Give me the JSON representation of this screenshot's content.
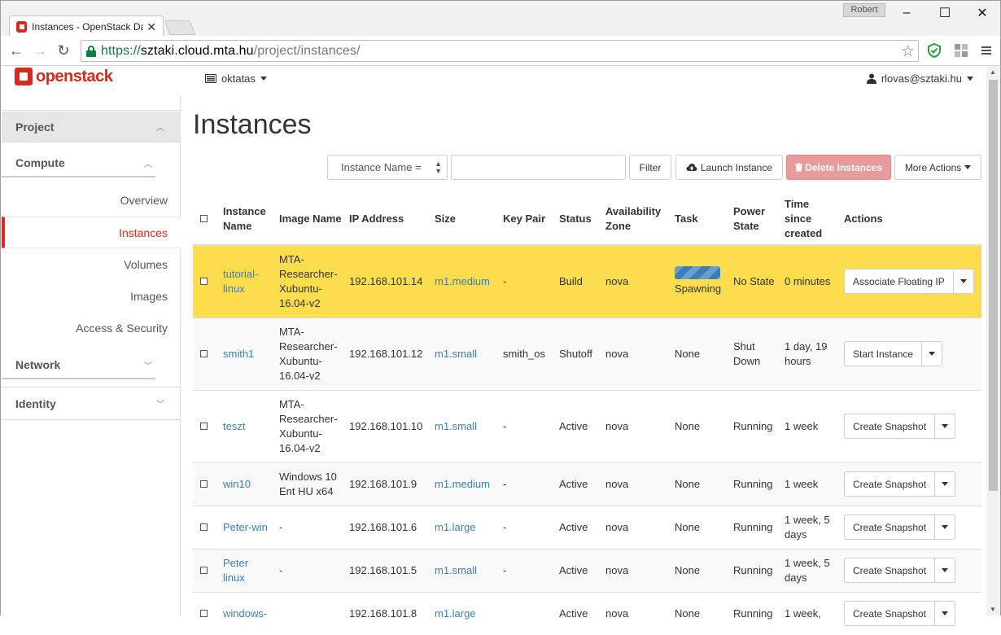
{
  "browser": {
    "tab_title": "Instances - OpenStack Da",
    "user_badge": "Robert",
    "url_scheme": "https://",
    "url_host": "sztaki.cloud.mta.hu",
    "url_path": "/project/instances/"
  },
  "header": {
    "logo_text": "openstack",
    "project": "oktatas",
    "user": "rlovas@sztaki.hu"
  },
  "sidebar": {
    "project": "Project",
    "compute": "Compute",
    "items": [
      "Overview",
      "Instances",
      "Volumes",
      "Images",
      "Access & Security"
    ],
    "active_item": "Instances",
    "network": "Network",
    "identity": "Identity"
  },
  "main": {
    "title": "Instances",
    "filter": {
      "field": "Instance Name =",
      "filter_label": "Filter",
      "launch_label": "Launch Instance",
      "delete_label": "Delete Instances",
      "more_label": "More Actions"
    },
    "columns": [
      "Instance Name",
      "Image Name",
      "IP Address",
      "Size",
      "Key Pair",
      "Status",
      "Availability Zone",
      "Task",
      "Power State",
      "Time since created",
      "Actions"
    ],
    "rows": [
      {
        "name": "tutorial-linux",
        "image": "MTA-Researcher-Xubuntu-16.04-v2",
        "ip": "192.168.101.14",
        "size": "m1.medium",
        "key": "-",
        "status": "Build",
        "zone": "nova",
        "task": "Spawning",
        "power": "No State",
        "time": "0 minutes",
        "action": "Associate Floating IP",
        "building": true
      },
      {
        "name": "smith1",
        "image": "MTA-Researcher-Xubuntu-16.04-v2",
        "ip": "192.168.101.12",
        "size": "m1.small",
        "key": "smith_os",
        "status": "Shutoff",
        "zone": "nova",
        "task": "None",
        "power": "Shut Down",
        "time": "1 day, 19 hours",
        "action": "Start Instance"
      },
      {
        "name": "teszt",
        "image": "MTA-Researcher-Xubuntu-16.04-v2",
        "ip": "192.168.101.10",
        "size": "m1.small",
        "key": "-",
        "status": "Active",
        "zone": "nova",
        "task": "None",
        "power": "Running",
        "time": "1 week",
        "action": "Create Snapshot"
      },
      {
        "name": "win10",
        "image": "Windows 10 Ent HU x64",
        "ip": "192.168.101.9",
        "size": "m1.medium",
        "key": "-",
        "status": "Active",
        "zone": "nova",
        "task": "None",
        "power": "Running",
        "time": "1 week",
        "action": "Create Snapshot"
      },
      {
        "name": "Peter-win",
        "image": "-",
        "ip": "192.168.101.6",
        "size": "m1.large",
        "key": "-",
        "status": "Active",
        "zone": "nova",
        "task": "None",
        "power": "Running",
        "time": "1 week, 5 days",
        "action": "Create Snapshot"
      },
      {
        "name": "Peter linux",
        "image": "-",
        "ip": "192.168.101.5",
        "size": "m1.small",
        "key": "-",
        "status": "Active",
        "zone": "nova",
        "task": "None",
        "power": "Running",
        "time": "1 week, 5 days",
        "action": "Create Snapshot"
      },
      {
        "name": "windows-",
        "image": "",
        "ip": "192.168.101.8",
        "size": "m1.large",
        "key": "",
        "status": "Active",
        "zone": "nova",
        "task": "None",
        "power": "Running",
        "time": "1 week,",
        "action": "Create Snapshot"
      }
    ]
  },
  "colors": {
    "accent": "#d52b1e",
    "link": "#3a7fba",
    "building_row": "#fcdd4e",
    "danger_button": "#e89b9b"
  }
}
